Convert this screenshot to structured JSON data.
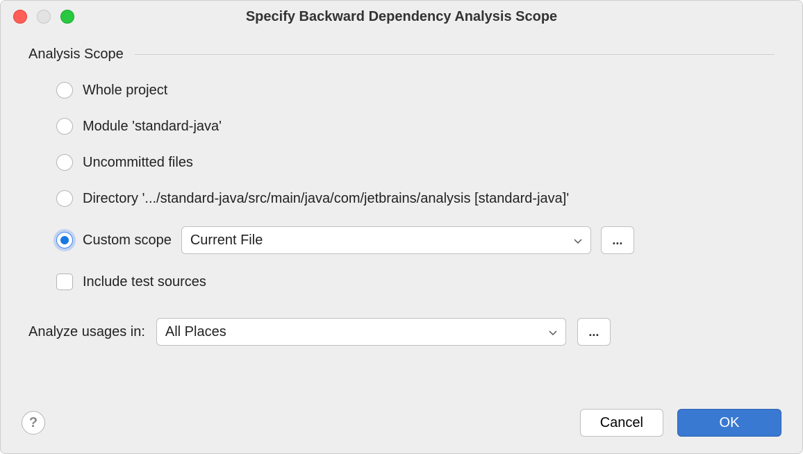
{
  "window": {
    "title": "Specify Backward Dependency Analysis Scope"
  },
  "section": {
    "title": "Analysis Scope"
  },
  "scope_options": {
    "whole_project": "Whole project",
    "module": "Module 'standard-java'",
    "uncommitted": "Uncommitted files",
    "directory": "Directory '.../standard-java/src/main/java/com/jetbrains/analysis [standard-java]'",
    "custom": "Custom scope"
  },
  "custom_scope_dropdown": {
    "selected": "Current File"
  },
  "include_test_sources": "Include test sources",
  "analyze_usages": {
    "label": "Analyze usages in:",
    "selected": "All Places"
  },
  "buttons": {
    "help": "?",
    "cancel": "Cancel",
    "ok": "OK",
    "ellipsis": "..."
  }
}
